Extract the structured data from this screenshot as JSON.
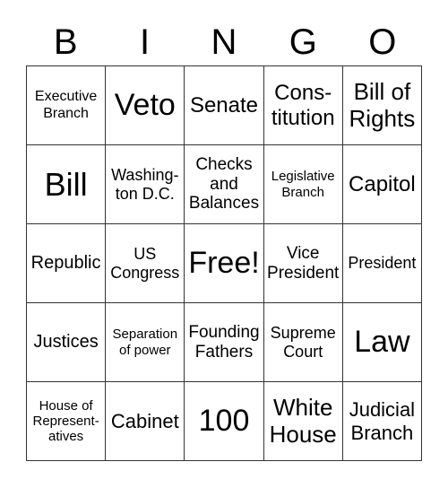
{
  "header": [
    "B",
    "I",
    "N",
    "G",
    "O"
  ],
  "rows": [
    [
      "Executive\nBranch",
      "Veto",
      "Senate",
      "Cons-\ntitution",
      "Bill of\nRights"
    ],
    [
      "Bill",
      "Washing-\nton D.C.",
      "Checks\nand\nBalances",
      "Legislative\nBranch",
      "Capitol"
    ],
    [
      "Republic",
      "US\nCongress",
      "Free!",
      "Vice\nPresident",
      "President"
    ],
    [
      "Justices",
      "Separation\nof power",
      "Founding\nFathers",
      "Supreme\nCourt",
      "Law"
    ],
    [
      "House of\nRepresent-\natives",
      "Cabinet",
      "100",
      "White\nHouse",
      "Judicial\nBranch"
    ]
  ]
}
